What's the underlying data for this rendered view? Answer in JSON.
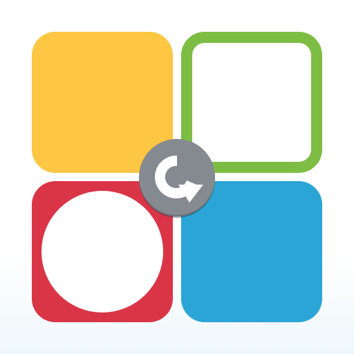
{
  "icon": {
    "tiles": [
      {
        "name": "yellow-tile",
        "color": "#fdc643"
      },
      {
        "name": "green-outlined-tile",
        "color": "#7dbd43"
      },
      {
        "name": "red-tile-with-circle",
        "color": "#d93547"
      },
      {
        "name": "blue-tile",
        "color": "#2aa5d6"
      }
    ],
    "center_button": {
      "icon": "refresh-icon",
      "color": "#858a90"
    }
  }
}
